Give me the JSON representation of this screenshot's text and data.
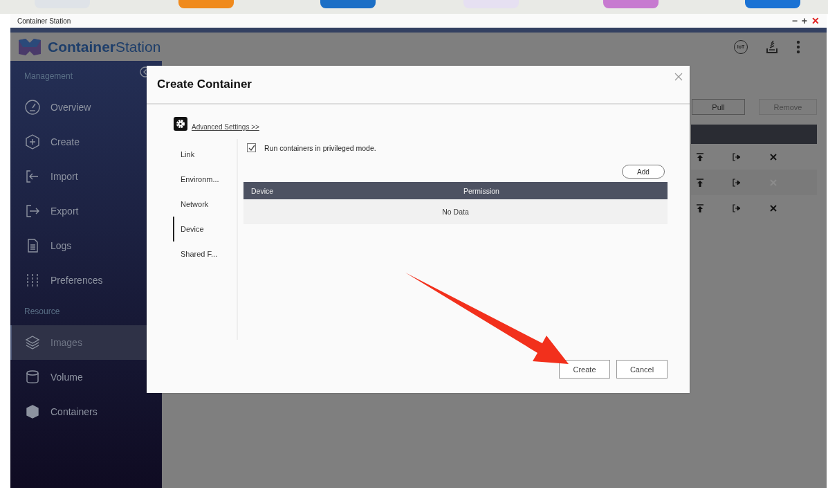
{
  "window": {
    "title": "Container Station",
    "controls": [
      "−",
      "+",
      "✕"
    ]
  },
  "header": {
    "logo": "**Container**Station",
    "iot": "IoT"
  },
  "sidebar": {
    "sections": [
      {
        "title": "Management",
        "items": [
          {
            "label": "Overview",
            "selected": false
          },
          {
            "label": "Create",
            "selected": false
          },
          {
            "label": "Import",
            "selected": false
          },
          {
            "label": "Export",
            "selected": false
          },
          {
            "label": "Logs",
            "selected": false
          },
          {
            "label": "Preferences",
            "selected": false
          }
        ]
      },
      {
        "title": "Resource",
        "items": [
          {
            "label": "Images",
            "selected": true
          },
          {
            "label": "Volume",
            "selected": false
          },
          {
            "label": "Containers",
            "selected": false
          }
        ]
      }
    ]
  },
  "toolbar": {
    "buttons": [
      {
        "label": "Pull",
        "disabled": false
      },
      {
        "label": "Remove",
        "disabled": true
      }
    ]
  },
  "rows": [
    {
      "remove_disabled": false
    },
    {
      "remove_disabled": true
    },
    {
      "remove_disabled": false
    }
  ],
  "dialog": {
    "title": "Create Container",
    "advanced_link": "Advanced Settings >>",
    "tabs": [
      {
        "label": "Link",
        "selected": false
      },
      {
        "label": "Environm...",
        "selected": false
      },
      {
        "label": "Network",
        "selected": false
      },
      {
        "label": "Device",
        "selected": true
      },
      {
        "label": "Shared F...",
        "selected": false
      }
    ],
    "privileged": {
      "label": "Run containers in privileged mode.",
      "checked": true
    },
    "add_button": "Add",
    "table": {
      "columns": [
        "Device",
        "Permission"
      ],
      "empty": "No Data"
    },
    "buttons": [
      "Create",
      "Cancel"
    ]
  }
}
